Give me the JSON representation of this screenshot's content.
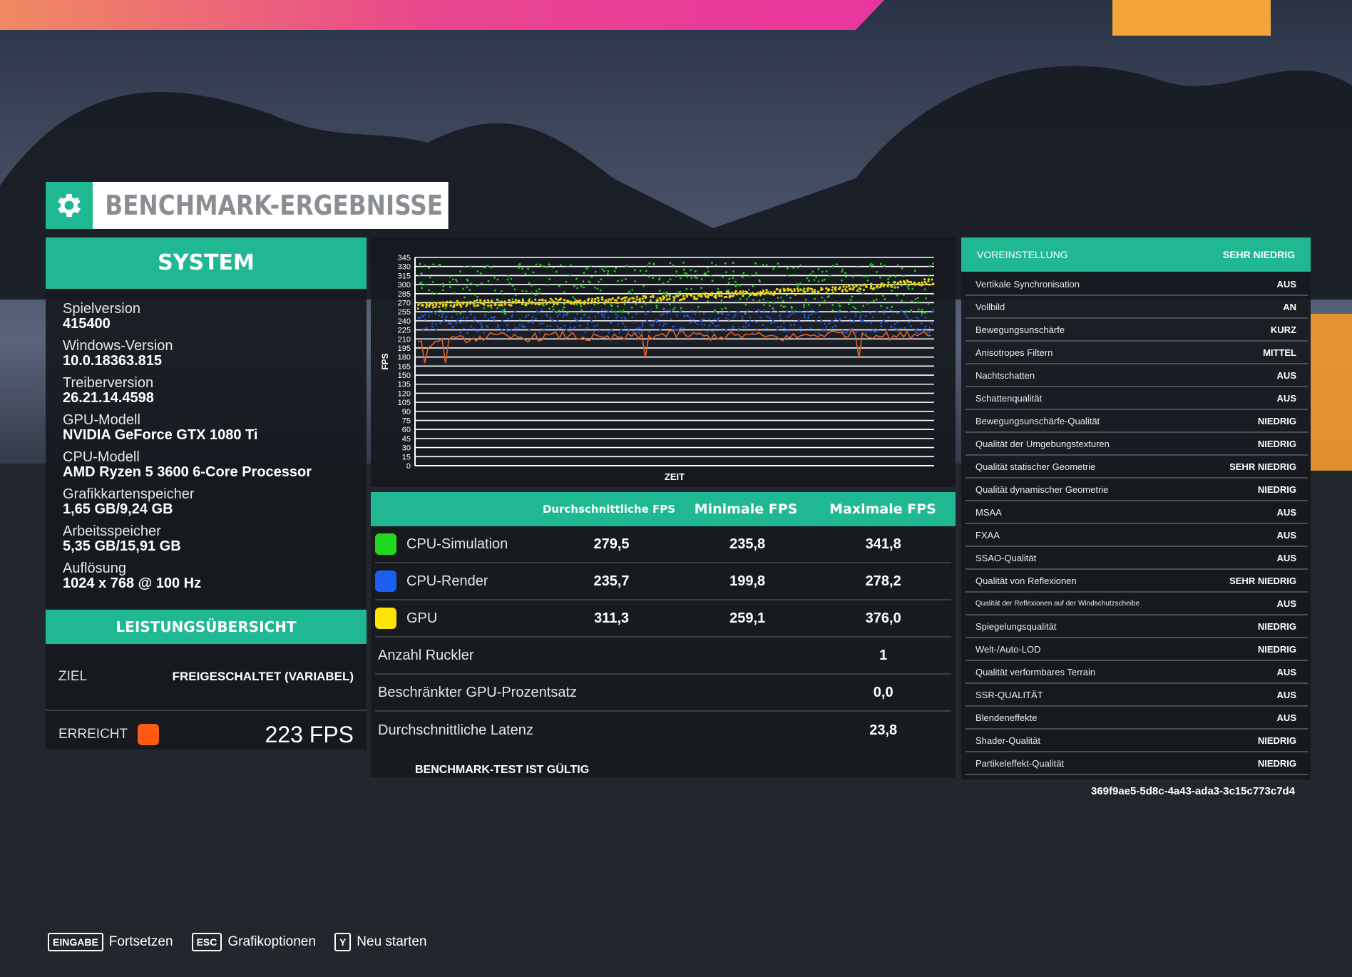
{
  "title": "BENCHMARK-ERGEBNISSE",
  "system": {
    "header": "SYSTEM",
    "items": [
      {
        "label": "Spielversion",
        "value": "415400"
      },
      {
        "label": "Windows-Version",
        "value": "10.0.18363.815"
      },
      {
        "label": "Treiberversion",
        "value": "26.21.14.4598"
      },
      {
        "label": "GPU-Modell",
        "value": "NVIDIA GeForce GTX 1080 Ti"
      },
      {
        "label": "CPU-Modell",
        "value": "AMD Ryzen 5 3600 6-Core Processor"
      },
      {
        "label": "Grafikkartenspeicher",
        "value": "1,65 GB/9,24 GB"
      },
      {
        "label": "Arbeitsspeicher",
        "value": "5,35 GB/15,91 GB"
      },
      {
        "label": "Auflösung",
        "value": "1024 x 768 @ 100 Hz"
      }
    ]
  },
  "performance": {
    "header": "LEISTUNGSÜBERSICHT",
    "target_label": "ZIEL",
    "target_value": "FREIGESCHALTET (VARIABEL)",
    "achieved_label": "ERREICHT",
    "achieved_value": "223 FPS",
    "achieved_color": "#ff5a14"
  },
  "chart_data": {
    "type": "scatter",
    "ylabel": "FPS",
    "xlabel": "ZEIT",
    "ylim": [
      0,
      345
    ],
    "yticks": [
      0,
      15,
      30,
      45,
      60,
      75,
      90,
      105,
      120,
      135,
      150,
      165,
      180,
      195,
      210,
      225,
      240,
      255,
      270,
      285,
      300,
      315,
      330,
      345
    ],
    "series": [
      {
        "name": "CPU-Simulation",
        "color": "#22c81e",
        "mean": 279.5,
        "min": 235.8,
        "max": 341.8
      },
      {
        "name": "CPU-Render",
        "color": "#1f4fd6",
        "mean": 235.7,
        "min": 199.8,
        "max": 278.2
      },
      {
        "name": "GPU",
        "color": "#e8d20e",
        "trend": [
          265,
          268,
          270,
          271,
          272,
          274,
          276,
          278,
          282,
          286,
          288,
          290,
          295,
          300,
          305
        ],
        "min": 259.1,
        "max": 376.0
      },
      {
        "color": "#e0602a",
        "trend": [
          200,
          208,
          214,
          212,
          216,
          210,
          214,
          218,
          214,
          216,
          212,
          218,
          220,
          214,
          222
        ],
        "dips": [
          170,
          178,
          180,
          182
        ]
      }
    ],
    "grid": true
  },
  "fps_table": {
    "headers": [
      "",
      "Durchschnittliche FPS",
      "Minimale FPS",
      "Maximale FPS"
    ],
    "rows": [
      {
        "label": "CPU-Simulation",
        "color": "#22d81e",
        "avg": "279,5",
        "min": "235,8",
        "max": "341,8"
      },
      {
        "label": "CPU-Render",
        "color": "#1c5ef2",
        "avg": "235,7",
        "min": "199,8",
        "max": "278,2"
      },
      {
        "label": "GPU",
        "color": "#ffe40a",
        "avg": "311,3",
        "min": "259,1",
        "max": "376,0"
      }
    ],
    "extra": [
      {
        "label": "Anzahl Ruckler",
        "value": "1"
      },
      {
        "label": "Beschränkter GPU-Prozentsatz",
        "value": "0,0"
      },
      {
        "label": "Durchschnittliche Latenz",
        "value": "23,8"
      }
    ],
    "valid_text": "BENCHMARK-TEST IST GÜLTIG"
  },
  "settings": {
    "preset_label": "VOREINSTELLUNG",
    "preset_value": "SEHR NIEDRIG",
    "items": [
      {
        "label": "Vertikale Synchronisation",
        "value": "AUS"
      },
      {
        "label": "Vollbild",
        "value": "AN"
      },
      {
        "label": "Bewegungsunschärfe",
        "value": "KURZ"
      },
      {
        "label": "Anisotropes Filtern",
        "value": "MITTEL"
      },
      {
        "label": "Nachtschatten",
        "value": "AUS"
      },
      {
        "label": "Schattenqualität",
        "value": "AUS"
      },
      {
        "label": "Bewegungsunschärfe-Qualität",
        "value": "NIEDRIG"
      },
      {
        "label": "Qualität der Umgebungstexturen",
        "value": "NIEDRIG"
      },
      {
        "label": "Qualität statischer Geometrie",
        "value": "SEHR NIEDRIG"
      },
      {
        "label": "Qualität dynamischer Geometrie",
        "value": "NIEDRIG"
      },
      {
        "label": "MSAA",
        "value": "AUS"
      },
      {
        "label": "FXAA",
        "value": "AUS"
      },
      {
        "label": "SSAO-Qualität",
        "value": "AUS"
      },
      {
        "label": "Qualität von Reflexionen",
        "value": "SEHR NIEDRIG"
      },
      {
        "label": "Qualität der Reflexionen auf der Windschutzscheibe",
        "value": "AUS"
      },
      {
        "label": "Spiegelungsqualität",
        "value": "NIEDRIG"
      },
      {
        "label": "Welt-/Auto-LOD",
        "value": "NIEDRIG"
      },
      {
        "label": "Qualität verformbares Terrain",
        "value": "AUS"
      },
      {
        "label": "SSR-QUALITÄT",
        "value": "AUS"
      },
      {
        "label": "Blendeneffekte",
        "value": "AUS"
      },
      {
        "label": "Shader-Qualität",
        "value": "NIEDRIG"
      },
      {
        "label": "Partikeleffekt-Qualität",
        "value": "NIEDRIG"
      }
    ],
    "guid": "369f9ae5-5d8c-4a43-ada3-3c15c773c7d4"
  },
  "footer": {
    "buttons": [
      {
        "key": "EINGABE",
        "label": "Fortsetzen"
      },
      {
        "key": "ESC",
        "label": "Grafikoptionen"
      },
      {
        "key": "Y",
        "label": "Neu starten"
      }
    ]
  },
  "colors": {
    "accent": "#1fb892",
    "panel": "#16191e"
  }
}
